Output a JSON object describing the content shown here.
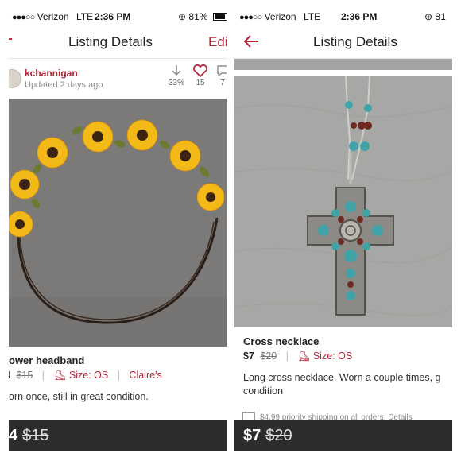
{
  "left": {
    "status": {
      "carrier": "Verizon",
      "network": "LTE",
      "time": "2:36 PM",
      "battery": "81%"
    },
    "nav": {
      "title": "Listing Details",
      "edit_label": "Edi"
    },
    "seller": {
      "username": "kchannigan",
      "updated": "Updated 2 days ago"
    },
    "stats": {
      "drop": "33%",
      "likes": "15",
      "comments": "7"
    },
    "item": {
      "title": "ower headband",
      "price": "4",
      "original_price": "$15",
      "size": "Size: OS",
      "brand": "Claire's",
      "description": "orn once, still in great condition."
    },
    "bottom": {
      "price": "4",
      "original_price": "$15"
    }
  },
  "right": {
    "status": {
      "carrier": "Verizon",
      "network": "LTE",
      "time": "2:36 PM",
      "battery": "81"
    },
    "nav": {
      "title": "Listing Details"
    },
    "item": {
      "title": "Cross necklace",
      "price": "$7",
      "original_price": "$20",
      "size": "Size: OS",
      "description": "Long cross necklace. Worn a couple times, g condition"
    },
    "shipping": "$4.99 priority shipping on all orders. Details",
    "bottom": {
      "price": "$7",
      "original_price": "$20"
    }
  },
  "colors": {
    "accent": "#b6243a",
    "bottom_bar": "#2c2c2c"
  }
}
